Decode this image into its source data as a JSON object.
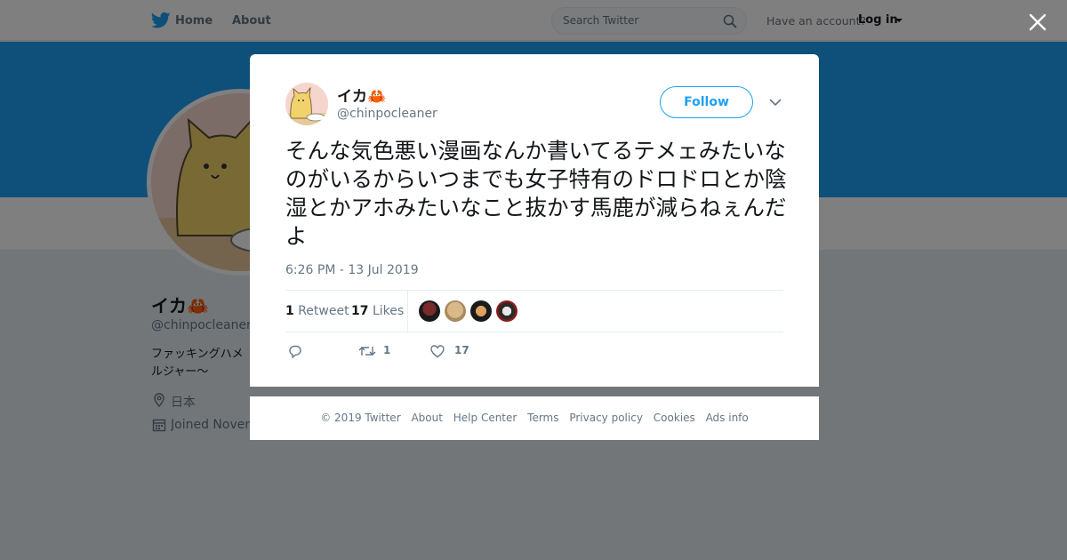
{
  "topbar": {
    "home_label": "Home",
    "about_label": "About",
    "search_placeholder": "Search Twitter",
    "have_account": "Have an account?",
    "login_label": "Log in"
  },
  "profile": {
    "name": "イカ🦀",
    "handle": "@chinpocleaner",
    "bio": "ファッキングハメ ルジャー〜",
    "location": "日本",
    "joined": "Joined Novem"
  },
  "tweet": {
    "name": "イカ🦀",
    "handle": "@chinpocleaner",
    "follow_label": "Follow",
    "text": "そんな気色悪い漫画なんか書いてるテメェみたいなのがいるからいつまでも女子特有のドロドロとか陰湿とかアホみたいなこと抜かす馬鹿が減らねぇんだよ",
    "timestamp": "6:26 PM - 13 Jul 2019",
    "retweet_count": "1",
    "retweet_label": "Retweet",
    "like_count": "17",
    "like_label": "Likes",
    "action_retweet_count": "1",
    "action_like_count": "17"
  },
  "footer": {
    "links": [
      "© 2019 Twitter",
      "About",
      "Help Center",
      "Terms",
      "Privacy policy",
      "Cookies",
      "Ads info"
    ]
  },
  "colors": {
    "brand": "#1da1f2",
    "banner": "#1da1f2"
  }
}
